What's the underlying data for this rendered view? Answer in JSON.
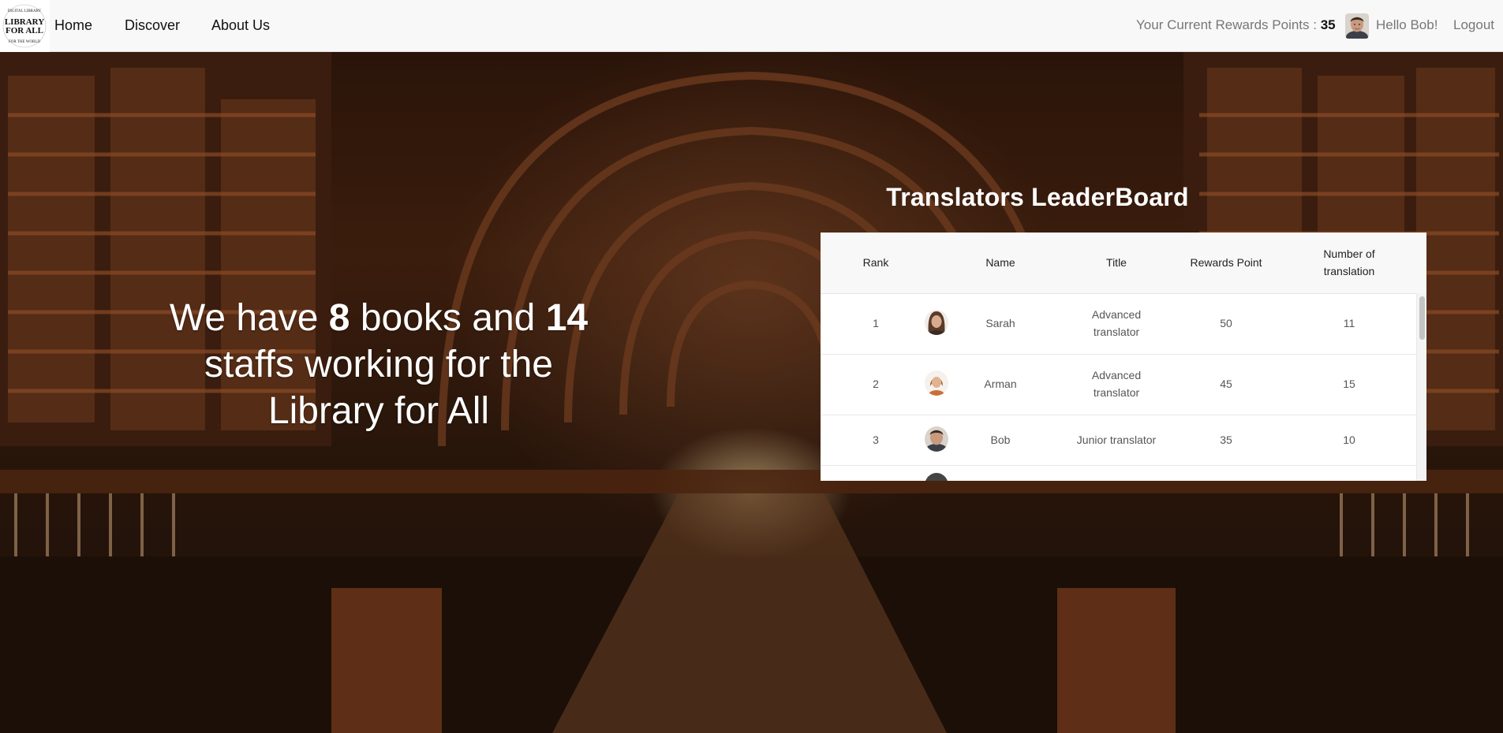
{
  "nav": {
    "logo_text_top": "DIGITAL LIBRARY",
    "logo_text_main_1": "LIBRARY",
    "logo_text_main_2": "FOR ALL",
    "logo_text_bottom": "FOR THE WORLD",
    "links": [
      "Home",
      "Discover",
      "About Us"
    ],
    "points_label": "Your Current Rewards Points : ",
    "points_value": "35",
    "greeting": "Hello Bob!",
    "logout": "Logout"
  },
  "hero": {
    "line_prefix": "We have ",
    "books_count": "8",
    "line_mid": " books and ",
    "staff_count": "14",
    "line_suffix": " staffs working for the Library for All"
  },
  "leaderboard": {
    "title": "Translators LeaderBoard",
    "headers": {
      "rank": "Rank",
      "name": "Name",
      "title": "Title",
      "points": "Rewards Point",
      "translations_1": "Number of",
      "translations_2": "translation"
    },
    "rows": [
      {
        "rank": "1",
        "name": "Sarah",
        "title_1": "Advanced",
        "title_2": "translator",
        "points": "50",
        "translations": "11"
      },
      {
        "rank": "2",
        "name": "Arman",
        "title_1": "Advanced",
        "title_2": "translator",
        "points": "45",
        "translations": "15"
      },
      {
        "rank": "3",
        "name": "Bob",
        "title_1": "Junior translator",
        "title_2": "",
        "points": "35",
        "translations": "10"
      }
    ]
  },
  "colors": {
    "navbar_bg": "#f8f8f8",
    "hero_text": "#ffffff",
    "table_bg": "#ffffff"
  },
  "icons": [
    "library-logo",
    "user-avatar-icon"
  ]
}
